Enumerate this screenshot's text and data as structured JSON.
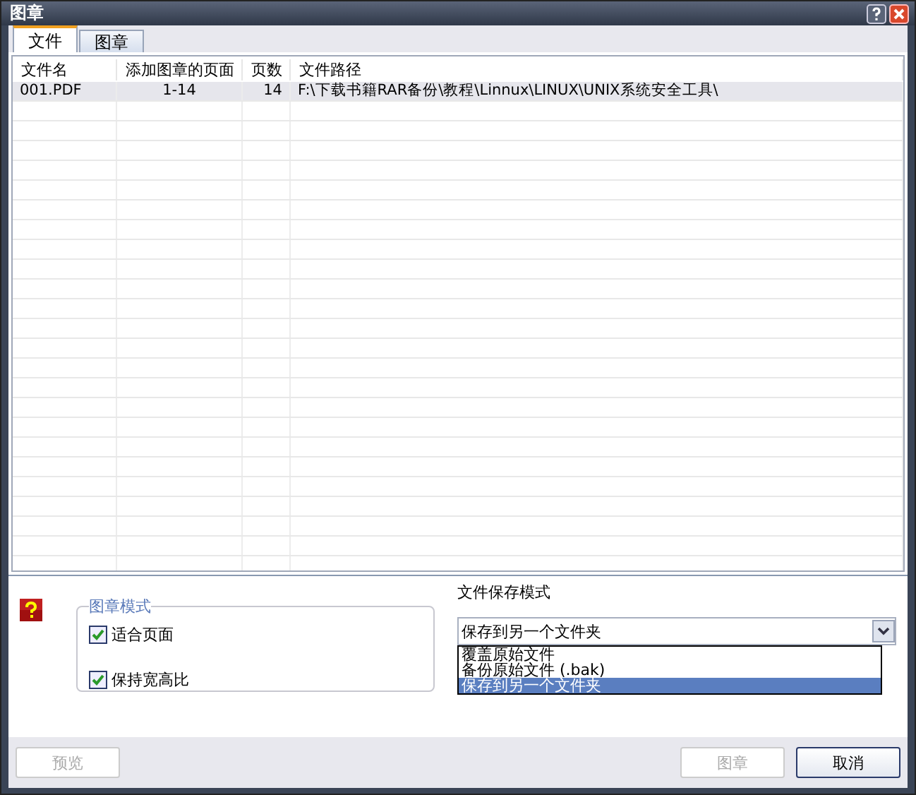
{
  "window": {
    "title": "图章"
  },
  "tabs": [
    {
      "label": "文件",
      "selected": true
    },
    {
      "label": "图章",
      "selected": false
    }
  ],
  "table": {
    "columns": [
      "文件名",
      "添加图章的页面",
      "页数",
      "文件路径"
    ],
    "rows": [
      {
        "selected": true,
        "cells": [
          "001.PDF",
          "1-14",
          "14",
          "F:\\下载书籍RAR备份\\教程\\Linnux\\LINUX\\UNIX系统安全工具\\"
        ]
      }
    ]
  },
  "stamp_mode": {
    "title": "图章模式",
    "options": [
      {
        "label": "适合页面",
        "checked": true
      },
      {
        "label": "保持宽高比",
        "checked": true
      }
    ]
  },
  "save_mode": {
    "label": "文件保存模式",
    "value": "保存到另一个文件夹",
    "expanded": true,
    "options": [
      {
        "label": "覆盖原始文件",
        "selected": false
      },
      {
        "label": "备份原始文件 (.bak)",
        "selected": false
      },
      {
        "label": "保存到另一个文件夹",
        "selected": true
      }
    ]
  },
  "buttons": [
    {
      "label": "预览",
      "disabled": true
    },
    {
      "label": "图章",
      "disabled": true
    },
    {
      "label": "取消",
      "disabled": false
    }
  ]
}
